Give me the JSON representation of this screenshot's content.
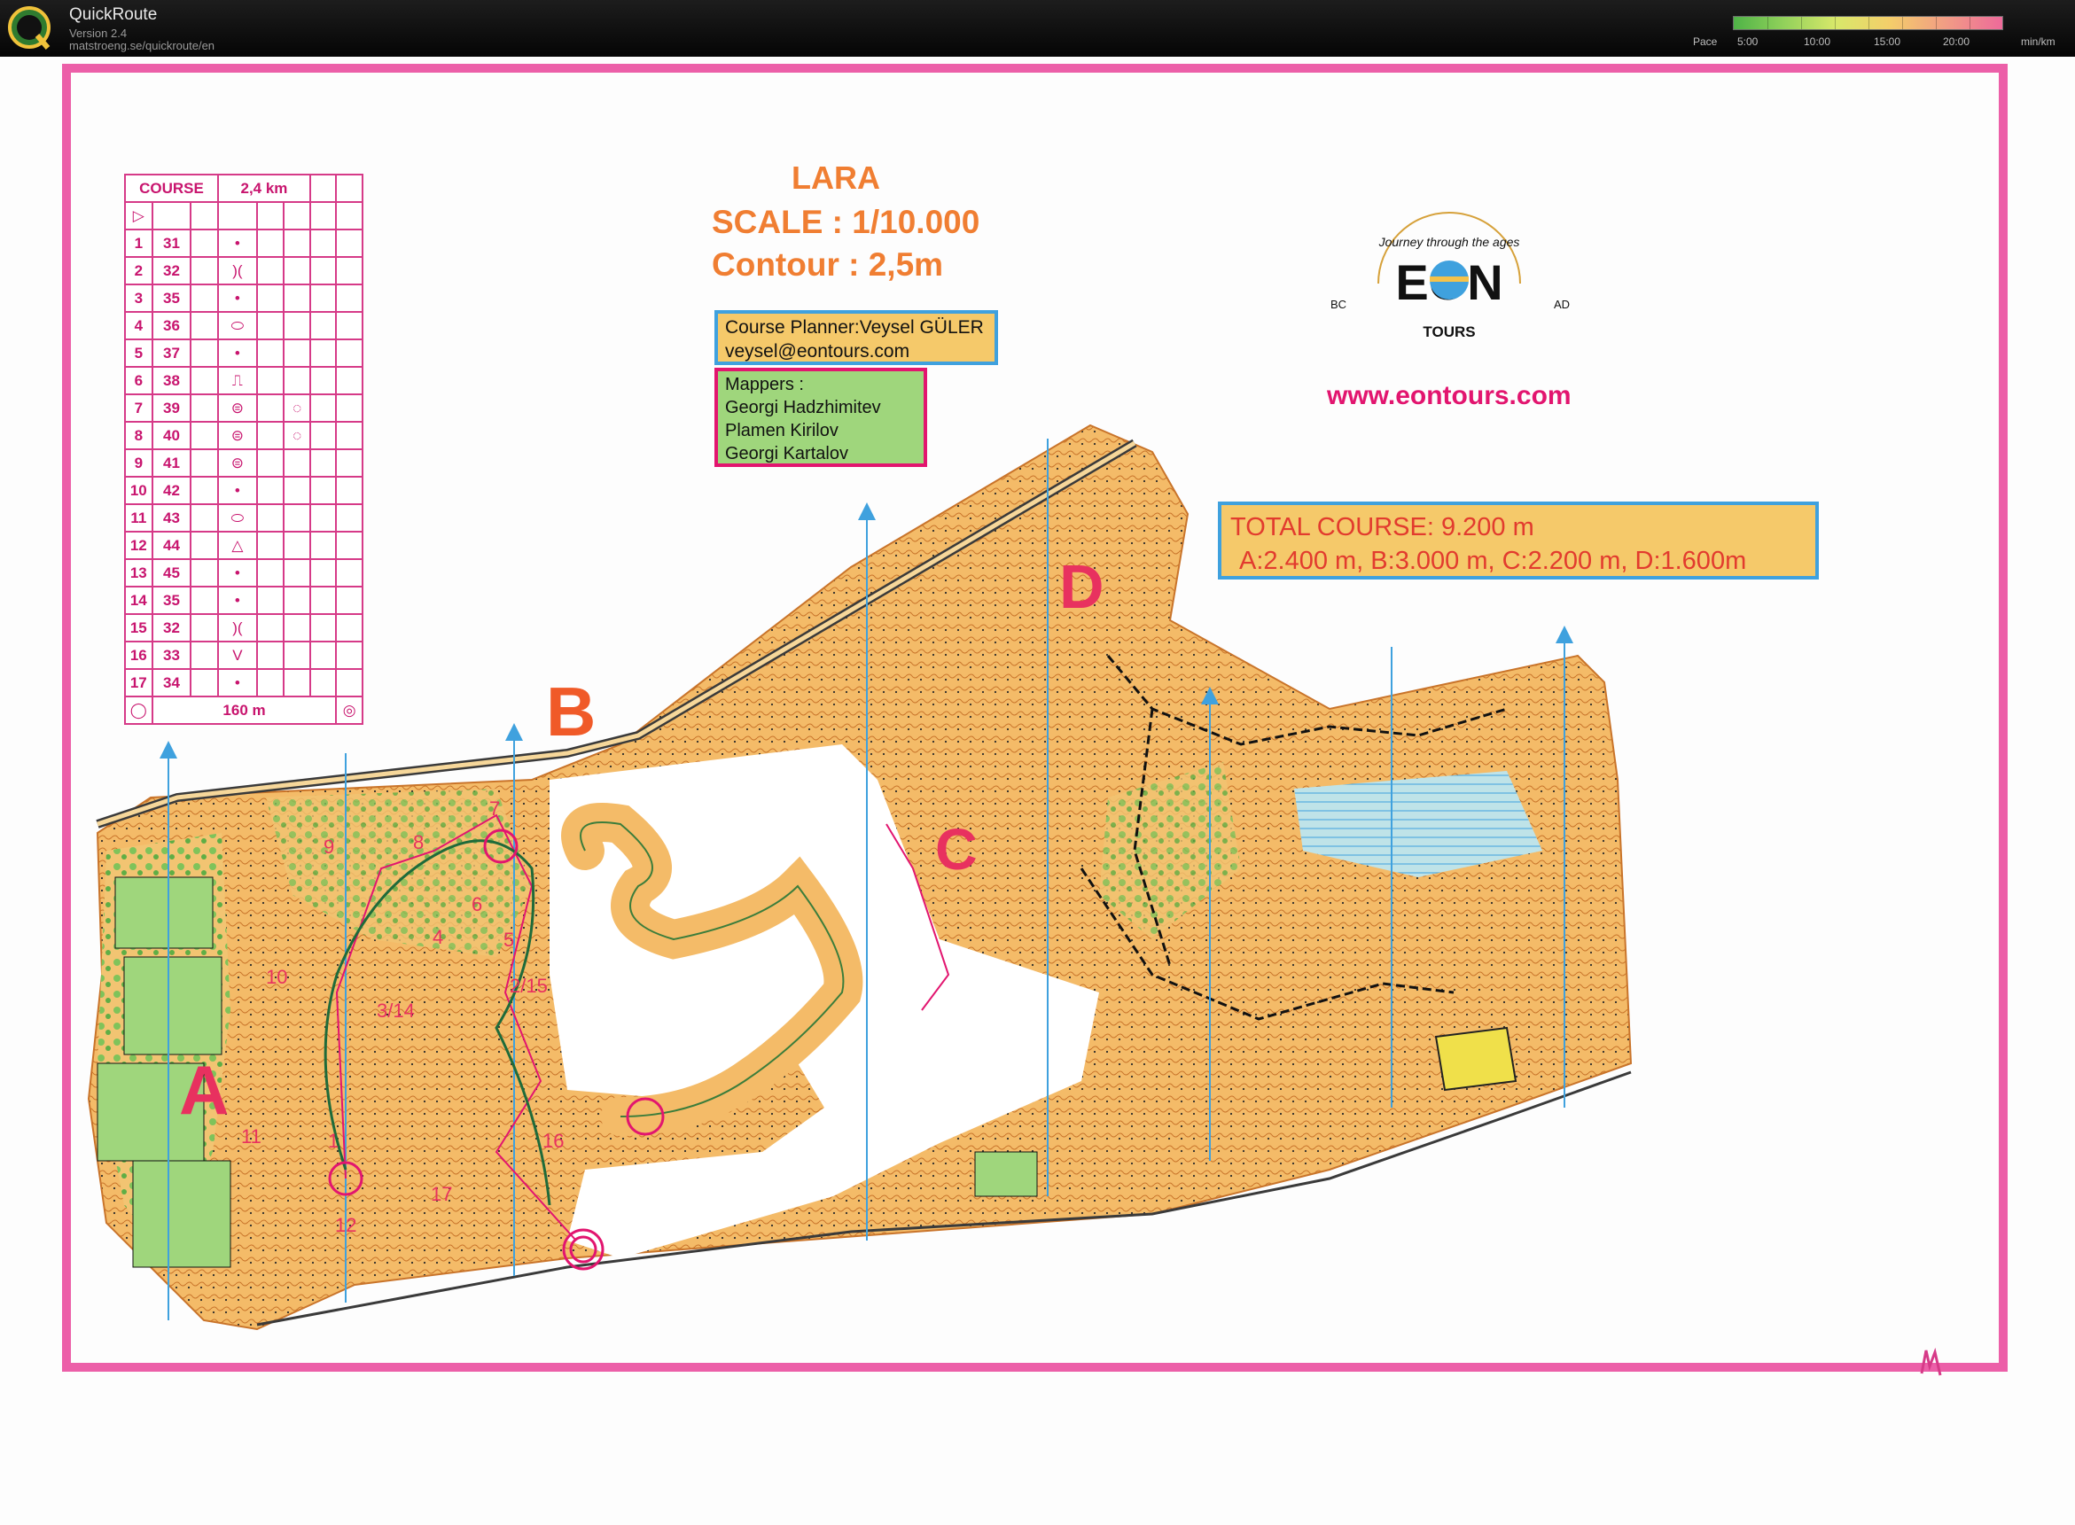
{
  "app": {
    "title": "QuickRoute",
    "version": "Version 2.4",
    "url": "matstroeng.se/quickroute/en",
    "pace_label": "Pace",
    "pace_ticks": [
      "5:00",
      "10:00",
      "15:00",
      "20:00"
    ],
    "pace_unit": "min/km"
  },
  "map": {
    "name": "LARA",
    "scale": "SCALE : 1/10.000",
    "contour": "Contour  : 2,5m",
    "planner_line1": "Course Planner:Veysel GÜLER",
    "planner_line2": "veysel@eontours.com",
    "mappers_title": "Mappers :",
    "mappers": [
      "Georgi Hadzhimitev",
      "Plamen Kirilov",
      "Georgi Kartalov"
    ],
    "total_course": "TOTAL COURSE: 9.200 m",
    "sections_lengths": "A:2.400 m, B:3.000 m, C:2.200 m, D:1.600m",
    "website": "www.eontours.com",
    "eon_brand": "EON",
    "eon_tagline": "Journey through the ages",
    "eon_sub": "TOURS",
    "eon_bc": "BC",
    "eon_ad": "AD",
    "sections": [
      "A",
      "B",
      "C",
      "D"
    ],
    "controls_on_map": [
      "1",
      "2/15",
      "3/14",
      "4",
      "5",
      "6",
      "7",
      "8",
      "9",
      "10",
      "11",
      "12",
      "16",
      "17"
    ]
  },
  "control_table": {
    "header_course": "COURSE",
    "header_length": "2,4 km",
    "finish_distance": "160 m",
    "rows": [
      {
        "n": "1",
        "code": "31",
        "sym": "•",
        "extra": ""
      },
      {
        "n": "2",
        "code": "32",
        "sym": ")(",
        "extra": ""
      },
      {
        "n": "3",
        "code": "35",
        "sym": "•",
        "extra": ""
      },
      {
        "n": "4",
        "code": "36",
        "sym": "⬭",
        "extra": ""
      },
      {
        "n": "5",
        "code": "37",
        "sym": "•",
        "extra": ""
      },
      {
        "n": "6",
        "code": "38",
        "sym": "⎍",
        "extra": ""
      },
      {
        "n": "7",
        "code": "39",
        "sym": "⊜",
        "extra": "◌"
      },
      {
        "n": "8",
        "code": "40",
        "sym": "⊜",
        "extra": "◌"
      },
      {
        "n": "9",
        "code": "41",
        "sym": "⊜",
        "extra": ""
      },
      {
        "n": "10",
        "code": "42",
        "sym": "•",
        "extra": ""
      },
      {
        "n": "11",
        "code": "43",
        "sym": "⬭",
        "extra": ""
      },
      {
        "n": "12",
        "code": "44",
        "sym": "△",
        "extra": ""
      },
      {
        "n": "13",
        "code": "45",
        "sym": "•",
        "extra": ""
      },
      {
        "n": "14",
        "code": "35",
        "sym": "•",
        "extra": ""
      },
      {
        "n": "15",
        "code": "32",
        "sym": ")(",
        "extra": ""
      },
      {
        "n": "16",
        "code": "33",
        "sym": "V",
        "extra": ""
      },
      {
        "n": "17",
        "code": "34",
        "sym": "•",
        "extra": ""
      }
    ]
  },
  "colors": {
    "frame": "#ec5fa8",
    "terrain": "#f2b25c",
    "vegetation": "#7fc35a",
    "course": "#e2156f",
    "title": "#f07e32",
    "pace_low": "#4fb347",
    "pace_high": "#ee6a9a"
  }
}
